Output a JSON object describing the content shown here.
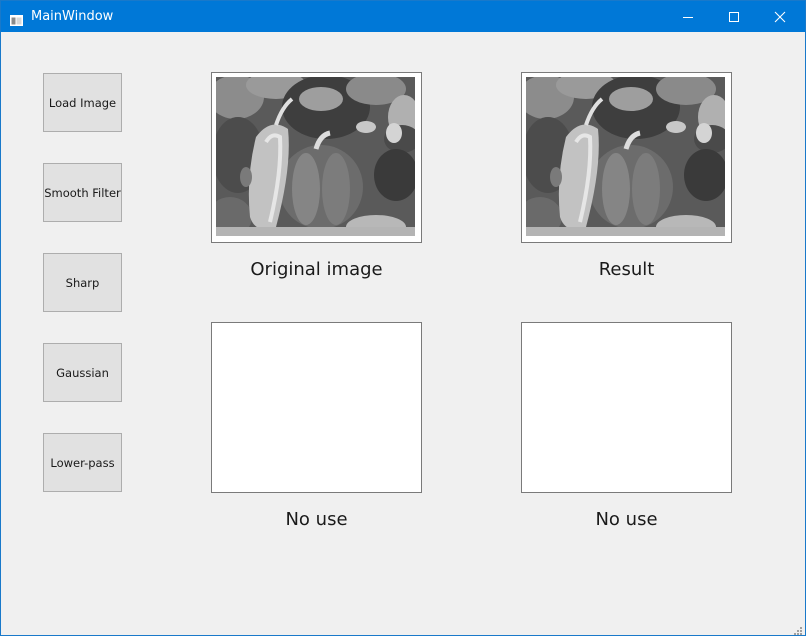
{
  "window": {
    "title": "MainWindow",
    "accent_color": "#0078d7",
    "icons": [
      "app-icon",
      "minimize-icon",
      "maximize-icon",
      "close-icon"
    ]
  },
  "sidebar": {
    "buttons": [
      {
        "label": "Load Image"
      },
      {
        "label": "Smooth Filter"
      },
      {
        "label": "Sharp"
      },
      {
        "label": "Gaussian"
      },
      {
        "label": "Lower-pass"
      }
    ]
  },
  "panels": {
    "original": {
      "caption": "Original image"
    },
    "result": {
      "caption": "Result"
    },
    "unused_left": {
      "caption": "No use"
    },
    "unused_right": {
      "caption": "No use"
    }
  }
}
